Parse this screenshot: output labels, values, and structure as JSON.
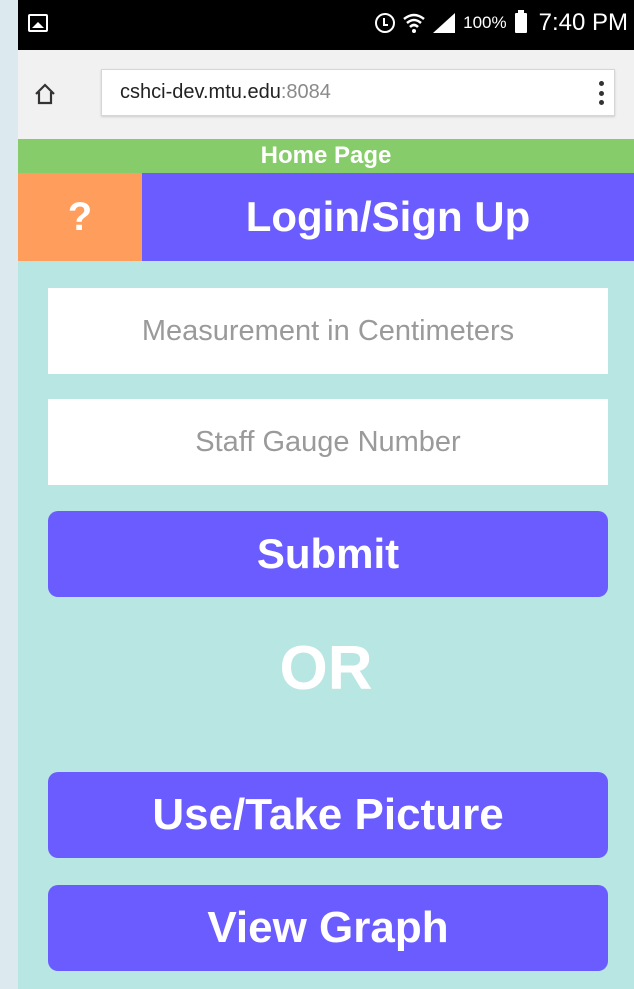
{
  "status_bar": {
    "battery_percent": "100%",
    "time": "7:40 PM",
    "icons": [
      "gallery-icon",
      "alarm-icon",
      "wifi-icon",
      "signal-icon",
      "battery-icon"
    ]
  },
  "browser": {
    "url_host": "cshci-dev.mtu.edu",
    "url_port": ":8084",
    "icons": [
      "home-icon",
      "menu-icon"
    ]
  },
  "page": {
    "banner": "Home Page",
    "help_label": "?",
    "login_label": "Login/Sign Up",
    "measurement_placeholder": "Measurement in Centimeters",
    "gauge_placeholder": "Staff Gauge Number",
    "submit_label": "Submit",
    "or_label": "OR",
    "picture_label": "Use/Take Picture",
    "graph_label": "View Graph"
  },
  "colors": {
    "banner": "#87cc6a",
    "help": "#ff9d5c",
    "primary": "#6a5cff",
    "background": "#b8e6e2"
  }
}
